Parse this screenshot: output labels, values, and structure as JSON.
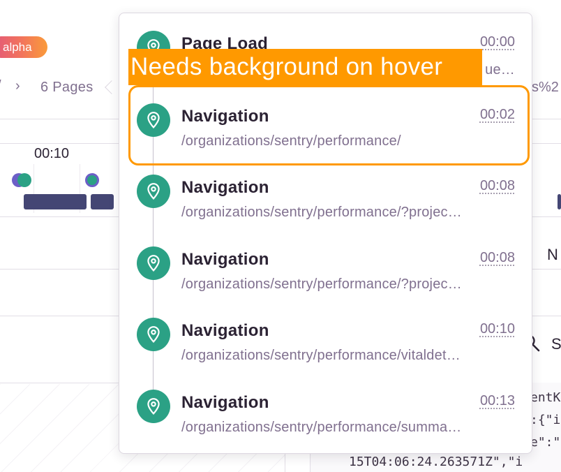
{
  "background": {
    "badge": "alpha",
    "breadcrumb_sep_left": "/",
    "breadcrumb_sep": "›",
    "pages_label": "6 Pages",
    "url_fragment": "s%2",
    "timeline_time": "00:10",
    "peek_n": "N",
    "peek_s": "S",
    "code_lines": [
      "entK",
      ":{\"i",
      "e\":\"",
      "15T04:06:24.263571Z\",\"i"
    ]
  },
  "popover": {
    "crumbs": [
      {
        "title": "Page Load",
        "time": "00:00",
        "url": "ue…"
      },
      {
        "title": "Navigation",
        "time": "00:02",
        "url": "/organizations/sentry/performance/"
      },
      {
        "title": "Navigation",
        "time": "00:08",
        "url": "/organizations/sentry/performance/?projec…"
      },
      {
        "title": "Navigation",
        "time": "00:08",
        "url": "/organizations/sentry/performance/?projec…"
      },
      {
        "title": "Navigation",
        "time": "00:10",
        "url": "/organizations/sentry/performance/vitaldet…"
      },
      {
        "title": "Navigation",
        "time": "00:13",
        "url": "/organizations/sentry/performance/summa…"
      }
    ],
    "icon": "location-pin-icon"
  },
  "annotation": {
    "label": "Needs background on hover"
  },
  "colors": {
    "accent_green": "#2ba185",
    "annotation_orange": "#ff9900",
    "bar_navy": "#444674",
    "dot_purple": "#6c5fc7"
  }
}
